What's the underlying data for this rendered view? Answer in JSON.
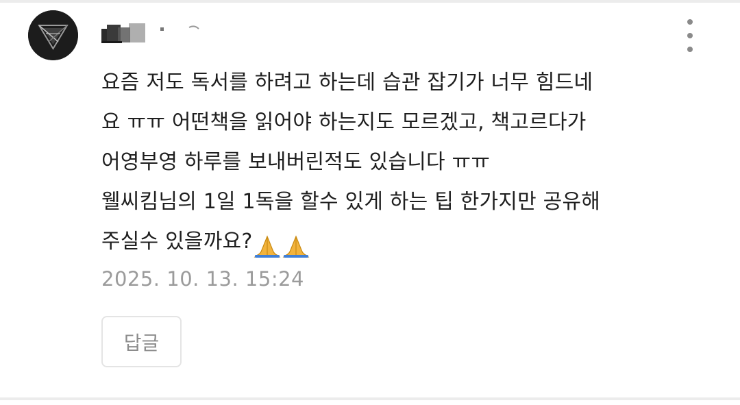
{
  "comment": {
    "author_name": "",
    "body_lines": [
      "요즘 저도 독서를 하려고 하는데 습관 잡기가 너무 힘드네",
      "요 ㅠㅠ 어떤책을 읽어야 하는지도 모르겠고, 책고르다가",
      "어영부영 하루를 보내버린적도 있습니다 ㅠㅠ",
      "웰씨킴님의 1일 1독을 할수 있게 하는 팁 한가지만 공유해",
      "주실수 있을까요?"
    ],
    "emoji": "🙏🙏",
    "timestamp": "2025. 10. 13. 15:24",
    "reply_label": "답글",
    "icons": {
      "avatar": "triangle-logo-icon",
      "more": "more-vertical-icon",
      "emoji": "folded-hands-icon"
    }
  },
  "colors": {
    "text": "#1f1f1f",
    "muted": "#9b9b9b",
    "border": "#e4e4e4",
    "avatar_bg": "#1c1c1c"
  }
}
